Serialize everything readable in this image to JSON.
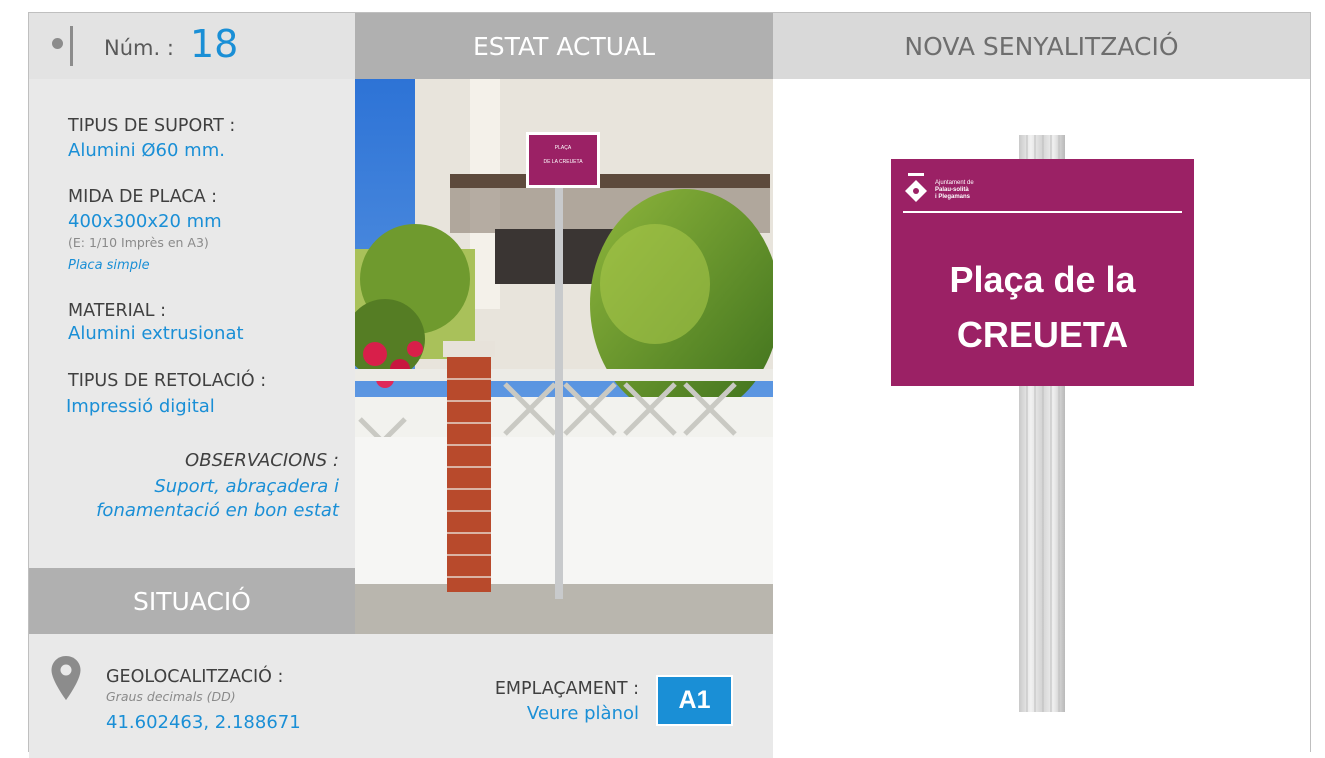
{
  "header": {
    "num_label": "Núm. :",
    "num_value": "18",
    "estat_actual": "ESTAT ACTUAL",
    "nova_senyalitzacio": "NOVA SENYALITZACIÓ"
  },
  "specs": {
    "suport_label": "TIPUS DE SUPORT :",
    "suport_value": "Alumini Ø60 mm.",
    "mida_label": "MIDA DE PLACA :",
    "mida_value": "400x300x20 mm",
    "mida_note": "(E: 1/10 Imprès en A3)",
    "mida_type": "Placa simple",
    "material_label": "MATERIAL :",
    "material_value": "Alumini extrusionat",
    "retolacio_label": "TIPUS DE RETOLACIÓ :",
    "retolacio_value": "Impressió digital",
    "obs_label": "OBSERVACIONS :",
    "obs_line1": "Suport, abraçadera i",
    "obs_line2": "fonamentació en bon estat"
  },
  "situacio": {
    "title": "SITUACIÓ",
    "geo_label": "GEOLOCALITZACIÓ :",
    "geo_format": "Graus decimals (DD)",
    "geo_value": "41.602463, 2.188671",
    "empl_label": "EMPLAÇAMENT :",
    "empl_link": "Veure plànol",
    "empl_code": "A1"
  },
  "photo": {
    "sign_line1": "PLAÇA",
    "sign_line2": "DE LA CREUETA"
  },
  "new_sign": {
    "logo_line1": "Ajuntament de",
    "logo_line2": "Palau-solità",
    "logo_line3": "i Plegamans",
    "line1": "Plaça de la",
    "line2": "CREUETA",
    "color": "#9b2165"
  },
  "colors": {
    "accent": "#1a8fd6",
    "header_dark": "#b0b0b0",
    "header_light": "#d9d9d9"
  }
}
